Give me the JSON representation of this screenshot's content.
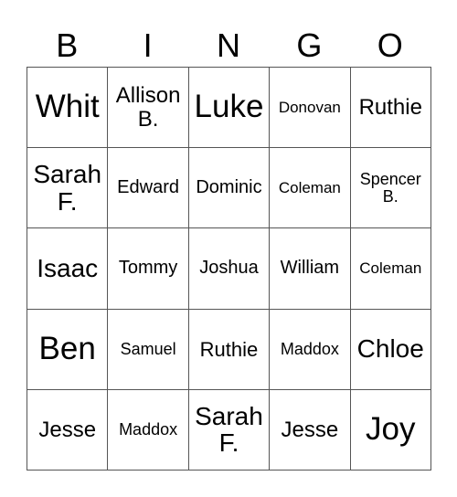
{
  "card": {
    "header": [
      "B",
      "I",
      "N",
      "G",
      "O"
    ],
    "rows": [
      [
        "Whit",
        "Allison B.",
        "Luke",
        "Donovan",
        "Ruthie"
      ],
      [
        "Sarah F.",
        "Edward",
        "Dominic",
        "Coleman",
        "Spencer B."
      ],
      [
        "Isaac",
        "Tommy",
        "Joshua",
        "William",
        "Coleman"
      ],
      [
        "Ben",
        "Samuel",
        "Ruthie",
        "Maddox",
        "Chloe"
      ],
      [
        "Jesse",
        "Maddox",
        "Sarah F.",
        "Jesse",
        "Joy"
      ]
    ]
  }
}
